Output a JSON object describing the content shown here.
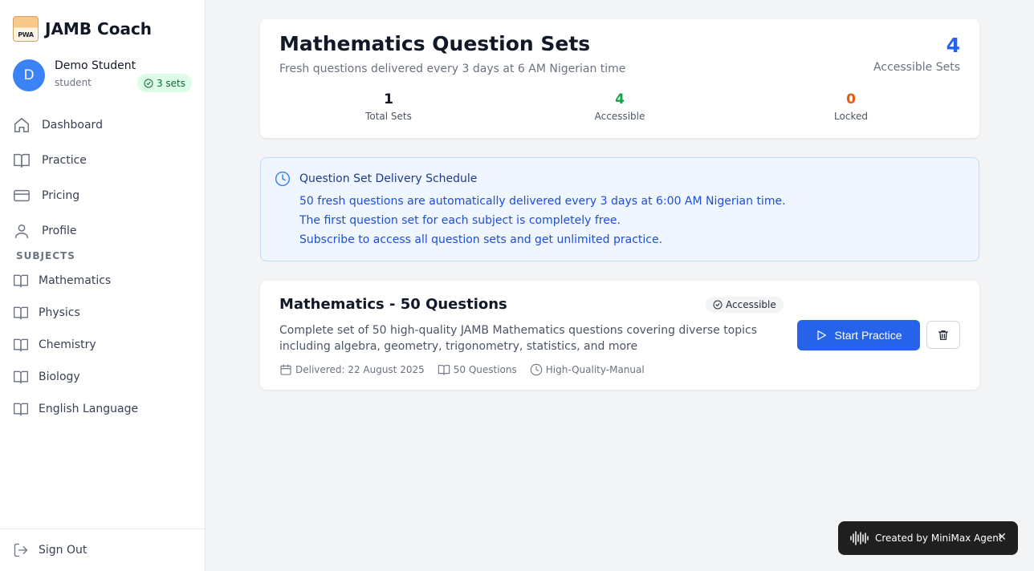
{
  "app": {
    "name": "JAMB Coach",
    "logo_text": "PWA"
  },
  "user": {
    "initial": "D",
    "name": "Demo Student",
    "role": "student",
    "sets_badge": "3 sets"
  },
  "nav": {
    "items": [
      {
        "label": "Dashboard",
        "icon": "home-icon"
      },
      {
        "label": "Practice",
        "icon": "book-icon"
      },
      {
        "label": "Pricing",
        "icon": "credit-card-icon"
      },
      {
        "label": "Profile",
        "icon": "user-icon"
      }
    ]
  },
  "subjects": {
    "heading": "SUBJECTS",
    "items": [
      "Mathematics",
      "Physics",
      "Chemistry",
      "Biology",
      "English Language"
    ]
  },
  "signout": {
    "label": "Sign Out"
  },
  "header": {
    "title": "Mathematics Question Sets",
    "subtitle": "Fresh questions delivered every 3 days at 6 AM Nigerian time",
    "accessible_count": "4",
    "accessible_label": "Accessible Sets",
    "stats": [
      {
        "value": "1",
        "label": "Total Sets",
        "color": "#111827"
      },
      {
        "value": "4",
        "label": "Accessible",
        "color": "#16a34a"
      },
      {
        "value": "0",
        "label": "Locked",
        "color": "#ea580c"
      }
    ]
  },
  "schedule": {
    "title": "Question Set Delivery Schedule",
    "lines": [
      "50 fresh questions are automatically delivered every 3 days at 6:00 AM Nigerian time.",
      "The first question set for each subject is completely free.",
      "Subscribe to access all question sets and get unlimited practice."
    ]
  },
  "question_set": {
    "title": "Mathematics - 50 Questions",
    "badge": "Accessible",
    "description": "Complete set of 50 high-quality JAMB Mathematics questions covering diverse topics including algebra, geometry, trigonometry, statistics, and more",
    "delivered": "Delivered: 22 August 2025",
    "count": "50 Questions",
    "quality": "High-Quality-Manual",
    "start_label": "Start Practice"
  },
  "toast": {
    "text": "Created by MiniMax Agent",
    "close": "✕"
  },
  "colors": {
    "accent": "#2563eb",
    "success": "#16a34a",
    "warning": "#ea580c"
  }
}
